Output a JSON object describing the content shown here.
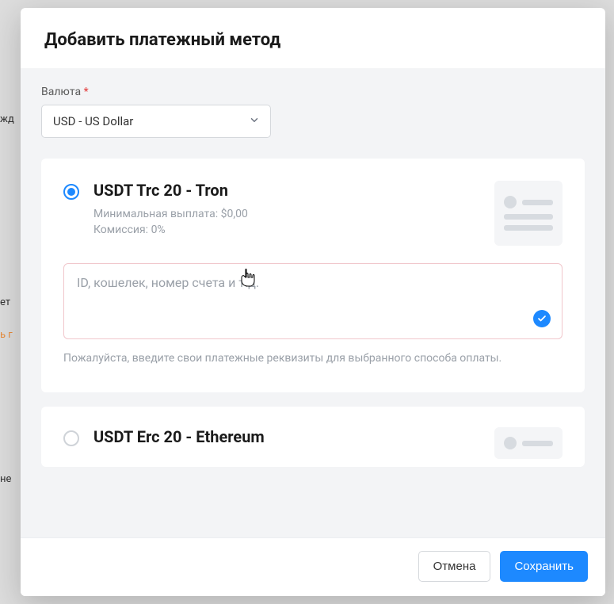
{
  "modal": {
    "title": "Добавить платежный метод",
    "currency": {
      "label": "Валюта",
      "required_mark": "*",
      "selected": "USD - US Dollar"
    },
    "options": [
      {
        "title": "USDT Trc 20 - Tron",
        "min_payout_label": "Минимальная выплата:",
        "min_payout_value": "$0,00",
        "fee_label": "Комиссия:",
        "fee_value": "0%",
        "selected": true,
        "input_placeholder": "ID, кошелек, номер счета и т.д.",
        "help_text": "Пожалуйста, введите свои платежные реквизиты для выбранного способа оплаты."
      },
      {
        "title": "USDT Erc 20 - Ethereum",
        "selected": false
      }
    ],
    "footer": {
      "cancel": "Отмена",
      "save": "Сохранить"
    }
  },
  "backdrop": {
    "t1": "жд",
    "t2": "ет",
    "t3": "ь г",
    "t4": "не"
  }
}
